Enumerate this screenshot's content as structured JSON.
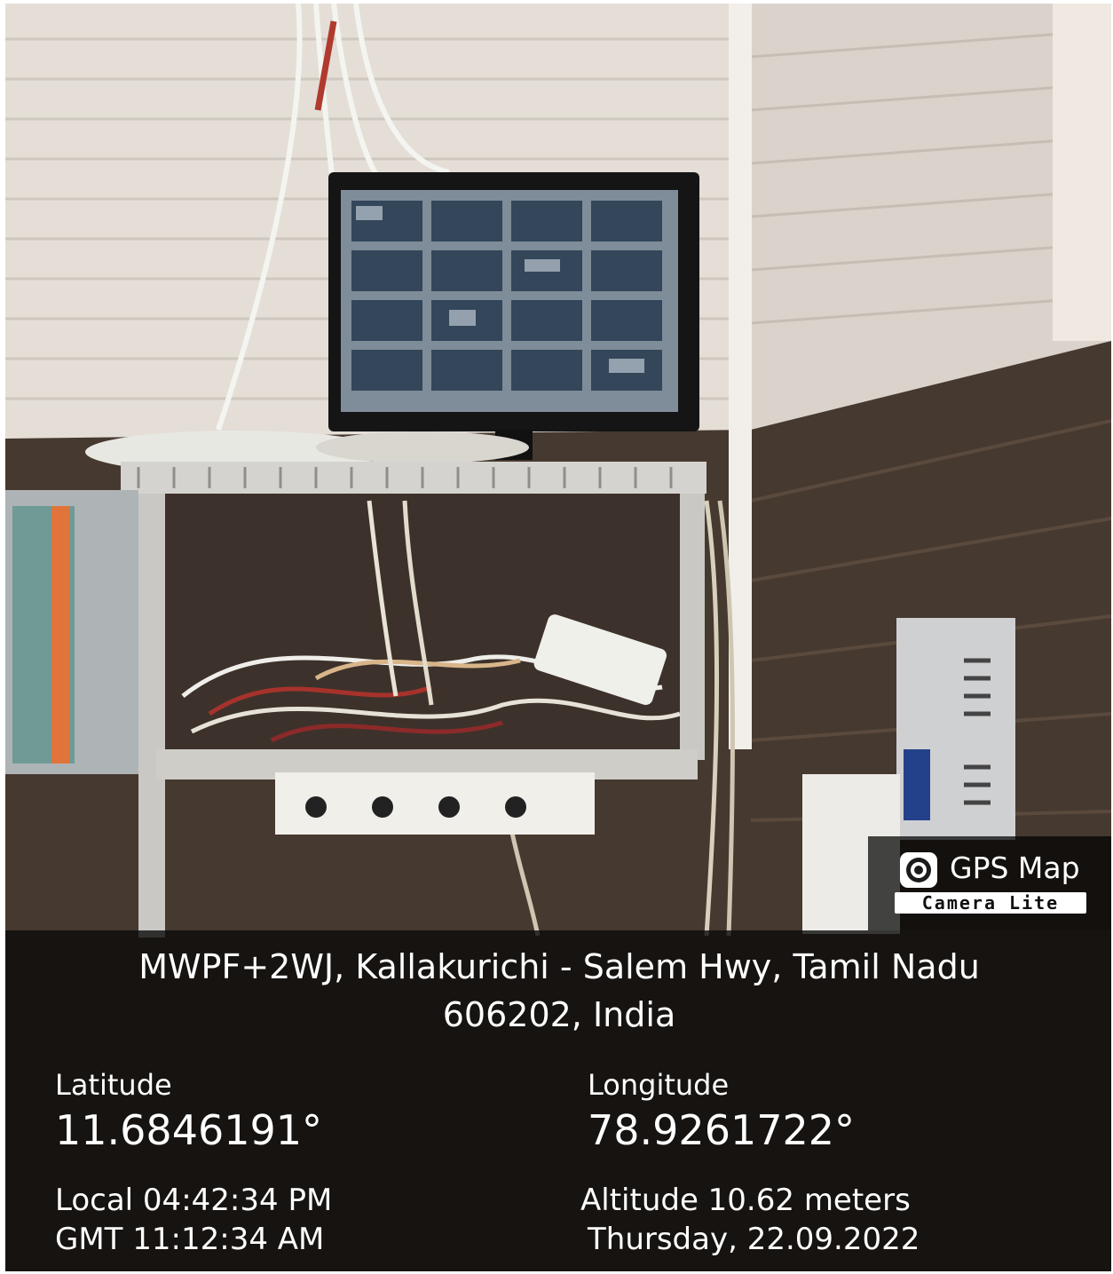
{
  "badge": {
    "title": "GPS Map",
    "subtitle": "Camera Lite",
    "logo_icon": "camera-lens-icon"
  },
  "location": {
    "address_line1": "MWPF+2WJ, Kallakurichi - Salem Hwy, Tamil Nadu",
    "address_line2": "606202, India",
    "latitude_label": "Latitude",
    "latitude_value": "11.6846191°",
    "longitude_label": "Longitude",
    "longitude_value": "78.9261722°",
    "local_time": "Local 04:42:34 PM",
    "gmt_time": "GMT 11:12:34 AM",
    "altitude": "Altitude 10.62 meters",
    "date": "Thursday, 22.09.2022"
  },
  "colors": {
    "overlay": "#0a0a0a",
    "text": "#ffffff",
    "wall": "#e6e1da",
    "wood_panel": "#4a3d33"
  }
}
